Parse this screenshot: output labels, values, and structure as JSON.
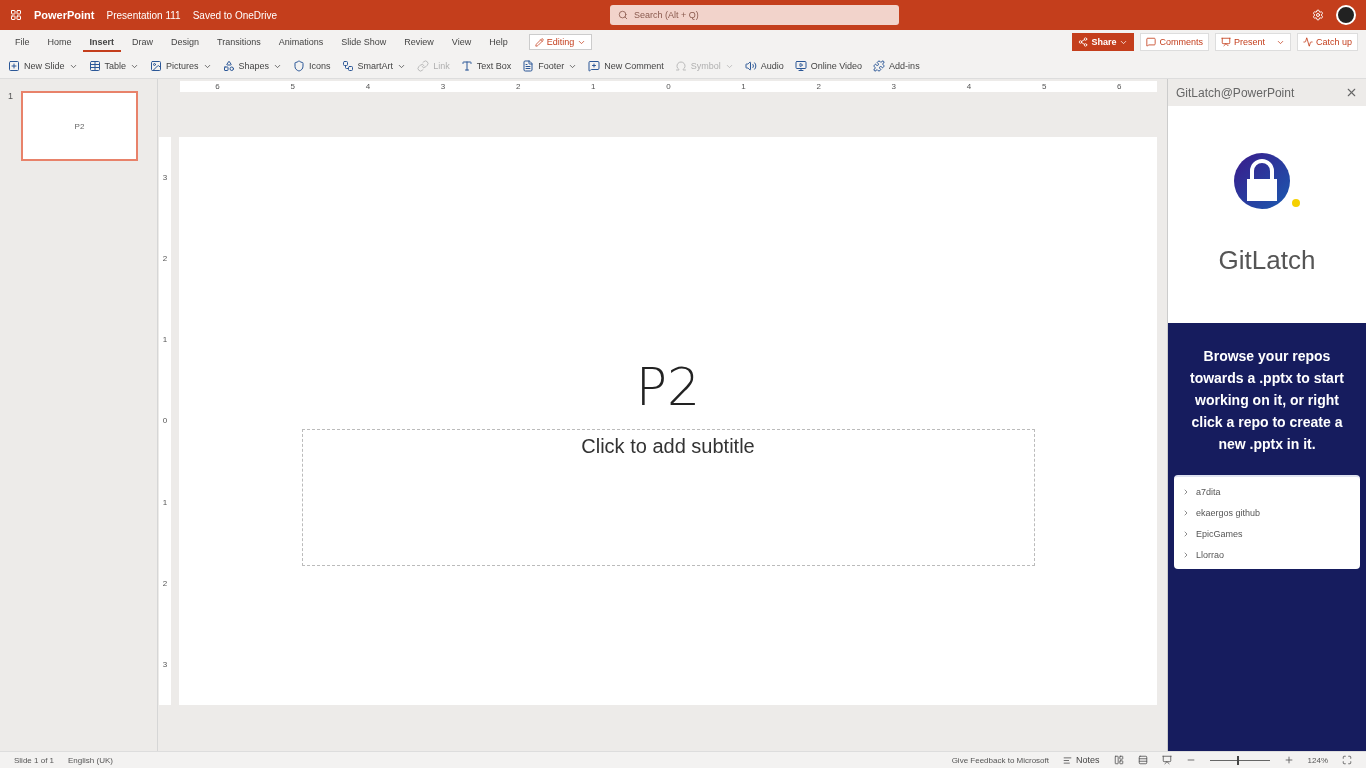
{
  "title_bar": {
    "app": "PowerPoint",
    "document": "Presentation 111",
    "save_status": "Saved to OneDrive",
    "search": {
      "placeholder": "Search (Alt + Q)"
    }
  },
  "ribbon_tabs": [
    {
      "label": "File",
      "selected": false
    },
    {
      "label": "Home",
      "selected": false
    },
    {
      "label": "Insert",
      "selected": true
    },
    {
      "label": "Draw",
      "selected": false
    },
    {
      "label": "Design",
      "selected": false
    },
    {
      "label": "Transitions",
      "selected": false
    },
    {
      "label": "Animations",
      "selected": false
    },
    {
      "label": "Slide Show",
      "selected": false
    },
    {
      "label": "Review",
      "selected": false
    },
    {
      "label": "View",
      "selected": false
    },
    {
      "label": "Help",
      "selected": false
    }
  ],
  "mode_button": "Editing",
  "actions": [
    {
      "label": "Share",
      "kind": "primary"
    },
    {
      "label": "Comments",
      "kind": "plain"
    },
    {
      "label": "Present",
      "kind": "split"
    },
    {
      "label": "Catch up",
      "kind": "plain"
    }
  ],
  "toolbar": [
    {
      "label": "New Slide",
      "dropdown": true,
      "disabled": false
    },
    {
      "label": "Table",
      "dropdown": true,
      "disabled": false
    },
    {
      "label": "Pictures",
      "dropdown": true,
      "disabled": false
    },
    {
      "label": "Shapes",
      "dropdown": true,
      "disabled": false
    },
    {
      "label": "Icons",
      "dropdown": false,
      "disabled": false
    },
    {
      "label": "SmartArt",
      "dropdown": true,
      "disabled": false
    },
    {
      "label": "Link",
      "dropdown": false,
      "disabled": true
    },
    {
      "label": "Text Box",
      "dropdown": false,
      "disabled": false
    },
    {
      "label": "Footer",
      "dropdown": true,
      "disabled": false
    },
    {
      "label": "New Comment",
      "dropdown": false,
      "disabled": false
    },
    {
      "label": "Symbol",
      "dropdown": true,
      "disabled": true
    },
    {
      "label": "Audio",
      "dropdown": false,
      "disabled": false
    },
    {
      "label": "Online Video",
      "dropdown": false,
      "disabled": false
    },
    {
      "label": "Add-ins",
      "dropdown": false,
      "disabled": false
    }
  ],
  "thumbnails": [
    {
      "number": "1",
      "text": "P2",
      "selected": true
    }
  ],
  "ruler_h": [
    "6",
    "5",
    "4",
    "3",
    "2",
    "1",
    "0",
    "1",
    "2",
    "3",
    "4",
    "5",
    "6"
  ],
  "ruler_v": [
    "3",
    "2",
    "1",
    "0",
    "1",
    "2",
    "3"
  ],
  "slide": {
    "title": "P2",
    "subtitle_placeholder": "Click to add subtitle"
  },
  "task_pane": {
    "title": "GitLatch@PowerPoint",
    "brand": "GitLatch",
    "message": "Browse your repos towards a .pptx to start working on it, or right click a repo to create a new .pptx in it.",
    "repos": [
      "a7dita",
      "ekaergos github",
      "EpicGames",
      "Llorrao"
    ]
  },
  "status_bar": {
    "slide_info": "Slide 1 of 1",
    "language": "English (UK)",
    "feedback": "Give Feedback to Microsoft",
    "notes": "Notes",
    "zoom": {
      "level": 0.45,
      "reading": "124%"
    }
  }
}
